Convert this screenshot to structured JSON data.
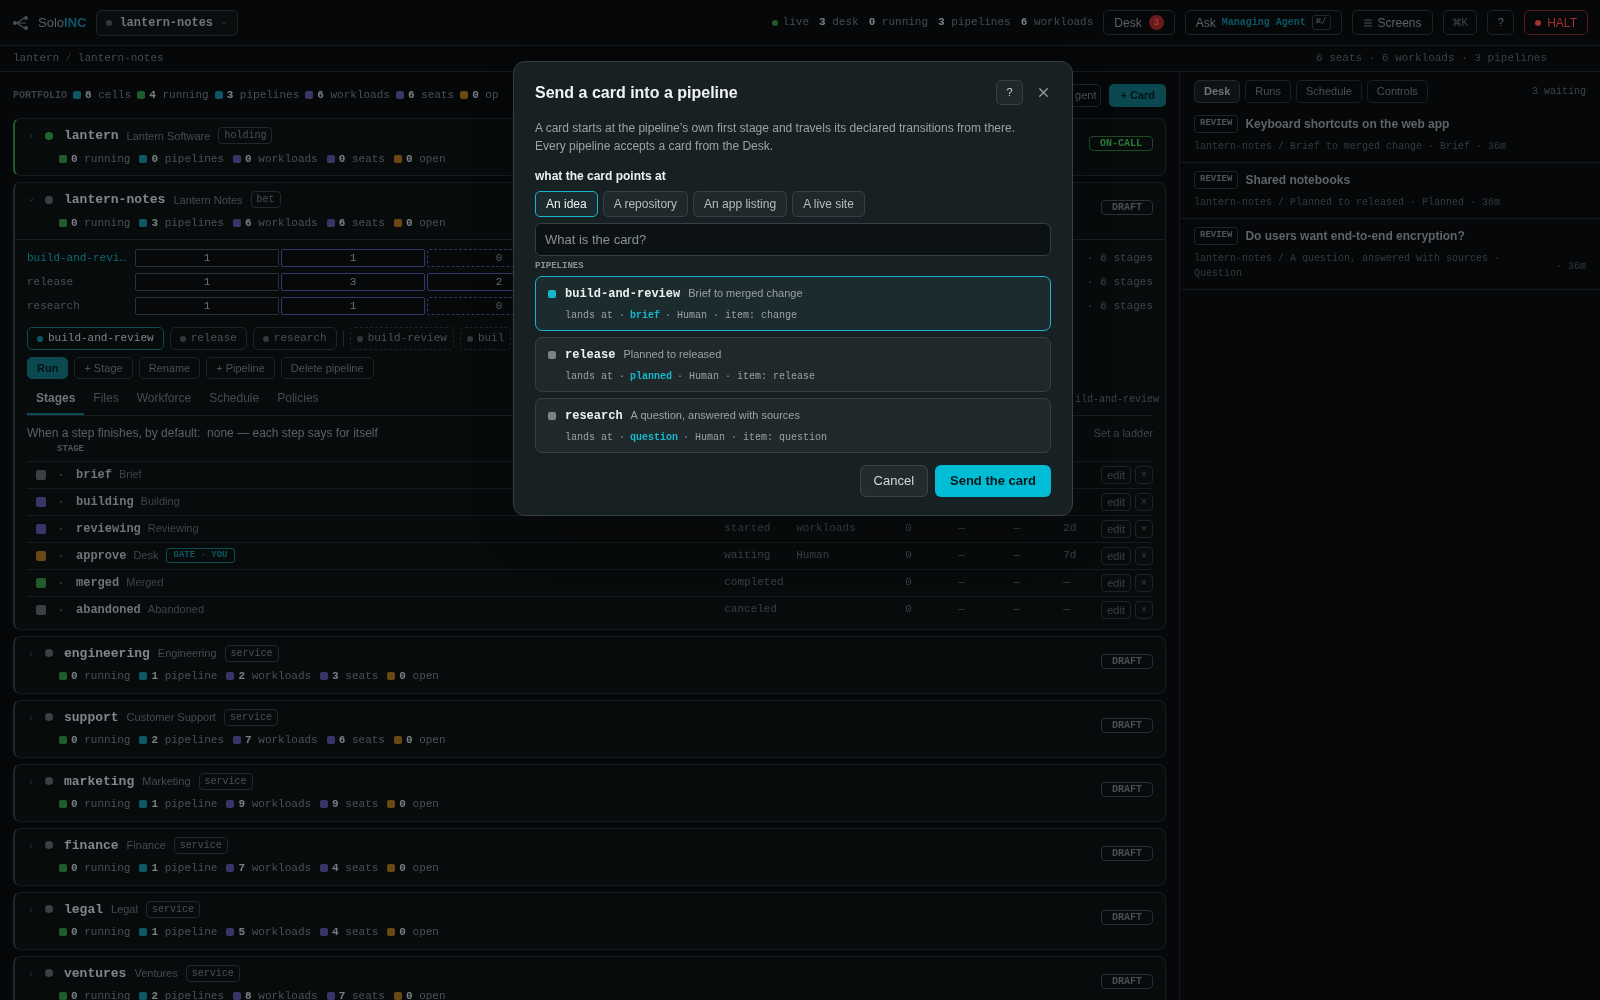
{
  "topbar": {
    "brand_prefix": "Solo",
    "brand_suffix": "INC",
    "project": "lantern-notes",
    "live": "live",
    "stats": [
      {
        "text": "**3** desk"
      },
      {
        "text": "**0** running"
      },
      {
        "text": "**3** pipelines"
      },
      {
        "text": "**6** workloads"
      }
    ],
    "desk": {
      "label": "Desk",
      "badge": "3"
    },
    "ask": {
      "label": "Ask",
      "agent": "Managing Agent",
      "shortcut": "⌘/"
    },
    "screens": "Screens",
    "palette": "⌘K",
    "help": "?",
    "halt": "HALT"
  },
  "breadcrumb": {
    "items": [
      "lantern",
      "lantern-notes"
    ],
    "separator": "/"
  },
  "summary": "6 seats · 6 workloads · 3 pipelines",
  "portfolio": {
    "label": "PORTFOLIO",
    "stats": [
      {
        "text": "**8** cells",
        "color": "#0d5864"
      },
      {
        "text": "**4** running",
        "color": "#1e5c2c"
      },
      {
        "text": "**3** pipelines",
        "color": "#0d5864"
      },
      {
        "text": "**6** workloads",
        "color": "#3b3468"
      },
      {
        "text": "**6** seats",
        "color": "#3b3468"
      },
      {
        "text": "**0** op",
        "color": "#6a4813"
      }
    ],
    "agent_button": "gent",
    "card_button": "+ Card"
  },
  "cells": [
    {
      "name": "lantern",
      "title": "Lantern Software",
      "tag": "holding",
      "badge": {
        "label": "ON-CALL",
        "kind": "oncall"
      },
      "color": "#1e6a2e",
      "expanded": false,
      "stats": [
        {
          "value": "0",
          "label": "running",
          "color": "#1e5c2c"
        },
        {
          "value": "0",
          "label": "pipelines",
          "color": "#0d5864"
        },
        {
          "value": "0",
          "label": "workloads",
          "color": "#3b3468"
        },
        {
          "value": "0",
          "label": "seats",
          "color": "#3b3468"
        },
        {
          "value": "0",
          "label": "open",
          "color": "#6a4813"
        }
      ]
    },
    {
      "name": "lantern-notes",
      "title": "Lantern Notes",
      "tag": "bet",
      "badge": {
        "label": "DRAFT",
        "kind": "draft"
      },
      "color": "#3a3f41",
      "expanded": true,
      "stats": [
        {
          "value": "0",
          "label": "running",
          "color": "#1e5c2c"
        },
        {
          "value": "3",
          "label": "pipelines",
          "color": "#0d5864"
        },
        {
          "value": "6",
          "label": "workloads",
          "color": "#3b3468"
        },
        {
          "value": "6",
          "label": "seats",
          "color": "#3b3468"
        },
        {
          "value": "0",
          "label": "open",
          "color": "#6a4813"
        }
      ],
      "detail": {
        "grid": [
          {
            "name": "build-and-revi…",
            "selected": true,
            "cells": [
              {
                "value": "1",
                "kind": "plain"
              },
              {
                "value": "1",
                "kind": "active"
              },
              {
                "value": "0",
                "kind": "empty"
              }
            ],
            "stages": "· 6 stages"
          },
          {
            "name": "release",
            "selected": false,
            "cells": [
              {
                "value": "1",
                "kind": "plain"
              },
              {
                "value": "3",
                "kind": "active"
              },
              {
                "value": "2",
                "kind": "active"
              }
            ],
            "stages": "· 6 stages"
          },
          {
            "name": "research",
            "selected": false,
            "cells": [
              {
                "value": "1",
                "kind": "plain"
              },
              {
                "value": "1",
                "kind": "active"
              },
              {
                "value": "0",
                "kind": "empty"
              }
            ],
            "stages": "· 6 stages"
          }
        ],
        "chips": [
          {
            "label": "build-and-review",
            "selected": true,
            "kind": "pipeline"
          },
          {
            "label": "release",
            "selected": false,
            "kind": "pipeline"
          },
          {
            "label": "research",
            "selected": false,
            "kind": "pipeline"
          },
          {
            "label": "build-review",
            "selected": false,
            "kind": "draft"
          },
          {
            "label": "buil",
            "selected": false,
            "kind": "draft"
          }
        ],
        "actions": [
          {
            "label": "Run",
            "kind": "primary"
          },
          {
            "label": "+ Stage",
            "kind": "plain"
          },
          {
            "label": "Rename",
            "kind": "plain"
          },
          {
            "label": "+ Pipeline",
            "kind": "plain"
          },
          {
            "label": "Delete pipeline",
            "kind": "plain"
          }
        ],
        "tabs": [
          {
            "label": "Stages",
            "selected": true
          },
          {
            "label": "Files",
            "selected": false
          },
          {
            "label": "Workforce",
            "selected": false
          },
          {
            "label": "Schedule",
            "selected": false
          },
          {
            "label": "Policies",
            "selected": false
          }
        ],
        "tabs_note": "ild-and-review",
        "default_line": "When a step finishes, by default:  none — each step says for itself",
        "ladder_link": "Set a ladder",
        "stage_header": "STAGE",
        "stages": [
          {
            "name": "brief",
            "title": "Brief",
            "color": "#3a3f41",
            "actions": [
              "edit",
              "×"
            ]
          },
          {
            "name": "building",
            "title": "Building",
            "color": "#3b3468",
            "actions": [
              "edit",
              "×"
            ]
          },
          {
            "name": "reviewing",
            "title": "Reviewing",
            "color": "#3b3468",
            "cols": {
              "status": "started",
              "role": "workloads",
              "count": "0",
              "column_5": "—",
              "column_6": "—",
              "time": "2d"
            },
            "actions": [
              "edit",
              "×"
            ]
          },
          {
            "name": "approve",
            "title": "Desk",
            "gate": "GATE · YOU",
            "color": "#6a4813",
            "cols": {
              "status": "waiting",
              "role": "Human",
              "count": "0",
              "column_5": "—",
              "column_6": "—",
              "time": "7d"
            },
            "actions": [
              "edit",
              "×"
            ]
          },
          {
            "name": "merged",
            "title": "Merged",
            "color": "#1e5c2c",
            "cols": {
              "status": "completed",
              "count": "0",
              "column_5": "—",
              "column_6": "—",
              "time": "—"
            },
            "actions": [
              "edit",
              "×"
            ]
          },
          {
            "name": "abandoned",
            "title": "Abandoned",
            "color": "#3a3f41",
            "cols": {
              "status": "canceled",
              "count": "0",
              "column_5": "—",
              "column_6": "—",
              "time": "—"
            },
            "actions": [
              "edit",
              "×"
            ]
          }
        ]
      }
    },
    {
      "name": "engineering",
      "title": "Engineering",
      "tag": "service",
      "badge": {
        "label": "DRAFT",
        "kind": "draft"
      },
      "color": "#3a3f41",
      "expanded": false,
      "stats": [
        {
          "value": "0",
          "label": "running",
          "color": "#1e5c2c"
        },
        {
          "value": "1",
          "label": "pipeline",
          "color": "#0d5864"
        },
        {
          "value": "2",
          "label": "workloads",
          "color": "#3b3468"
        },
        {
          "value": "3",
          "label": "seats",
          "color": "#3b3468"
        },
        {
          "value": "0",
          "label": "open",
          "color": "#6a4813"
        }
      ]
    },
    {
      "name": "support",
      "title": "Customer Support",
      "tag": "service",
      "badge": {
        "label": "DRAFT",
        "kind": "draft"
      },
      "color": "#3a3f41",
      "expanded": false,
      "stats": [
        {
          "value": "0",
          "label": "running",
          "color": "#1e5c2c"
        },
        {
          "value": "2",
          "label": "pipelines",
          "color": "#0d5864"
        },
        {
          "value": "7",
          "label": "workloads",
          "color": "#3b3468"
        },
        {
          "value": "6",
          "label": "seats",
          "color": "#3b3468"
        },
        {
          "value": "0",
          "label": "open",
          "color": "#6a4813"
        }
      ]
    },
    {
      "name": "marketing",
      "title": "Marketing",
      "tag": "service",
      "badge": {
        "label": "DRAFT",
        "kind": "draft"
      },
      "color": "#3a3f41",
      "expanded": false,
      "stats": [
        {
          "value": "0",
          "label": "running",
          "color": "#1e5c2c"
        },
        {
          "value": "1",
          "label": "pipeline",
          "color": "#0d5864"
        },
        {
          "value": "9",
          "label": "workloads",
          "color": "#3b3468"
        },
        {
          "value": "9",
          "label": "seats",
          "color": "#3b3468"
        },
        {
          "value": "0",
          "label": "open",
          "color": "#6a4813"
        }
      ]
    },
    {
      "name": "finance",
      "title": "Finance",
      "tag": "service",
      "badge": {
        "label": "DRAFT",
        "kind": "draft"
      },
      "color": "#3a3f41",
      "expanded": false,
      "stats": [
        {
          "value": "0",
          "label": "running",
          "color": "#1e5c2c"
        },
        {
          "value": "1",
          "label": "pipeline",
          "color": "#0d5864"
        },
        {
          "value": "7",
          "label": "workloads",
          "color": "#3b3468"
        },
        {
          "value": "4",
          "label": "seats",
          "color": "#3b3468"
        },
        {
          "value": "0",
          "label": "open",
          "color": "#6a4813"
        }
      ]
    },
    {
      "name": "legal",
      "title": "Legal",
      "tag": "service",
      "badge": {
        "label": "DRAFT",
        "kind": "draft"
      },
      "color": "#3a3f41",
      "expanded": false,
      "stats": [
        {
          "value": "0",
          "label": "running",
          "color": "#1e5c2c"
        },
        {
          "value": "1",
          "label": "pipeline",
          "color": "#0d5864"
        },
        {
          "value": "5",
          "label": "workloads",
          "color": "#3b3468"
        },
        {
          "value": "4",
          "label": "seats",
          "color": "#3b3468"
        },
        {
          "value": "0",
          "label": "open",
          "color": "#6a4813"
        }
      ]
    },
    {
      "name": "ventures",
      "title": "Ventures",
      "tag": "service",
      "badge": {
        "label": "DRAFT",
        "kind": "draft"
      },
      "color": "#3a3f41",
      "expanded": false,
      "stats": [
        {
          "value": "0",
          "label": "running",
          "color": "#1e5c2c"
        },
        {
          "value": "2",
          "label": "pipelines",
          "color": "#0d5864"
        },
        {
          "value": "8",
          "label": "workloads",
          "color": "#3b3468"
        },
        {
          "value": "7",
          "label": "seats",
          "color": "#3b3468"
        },
        {
          "value": "0",
          "label": "open",
          "color": "#6a4813"
        }
      ]
    }
  ],
  "desk_panel": {
    "tabs": [
      {
        "label": "Desk",
        "selected": true
      },
      {
        "label": "Runs",
        "selected": false
      },
      {
        "label": "Schedule",
        "selected": false
      },
      {
        "label": "Controls",
        "selected": false
      }
    ],
    "count": "3 waiting",
    "items": [
      {
        "tag": "REVIEW",
        "title": "Keyboard shortcuts on the web app",
        "meta": "lantern-notes / Brief to merged change · Brief",
        "time": "· 36m"
      },
      {
        "tag": "REVIEW",
        "title": "Shared notebooks",
        "meta": "lantern-notes / Planned to released · Planned",
        "time": "· 36m"
      },
      {
        "tag": "REVIEW",
        "title": "Do users want end-to-end encryption?",
        "meta": "lantern-notes / A question, answered with sources · Question",
        "time": "· 36m"
      }
    ]
  },
  "modal": {
    "title": "Send a card into a pipeline",
    "help": "?",
    "description": "A card starts at the pipeline’s own first stage and travels its declared transitions from there. Every pipeline accepts a card from the Desk.",
    "target_label": "what the card points at",
    "targets": [
      {
        "label": "An idea",
        "selected": true
      },
      {
        "label": "A repository",
        "selected": false
      },
      {
        "label": "An app listing",
        "selected": false
      },
      {
        "label": "A live site",
        "selected": false
      }
    ],
    "placeholder": "What is the card?",
    "section": "PIPELINES",
    "pipelines": [
      {
        "name": "build-and-review",
        "desc": "Brief to merged change",
        "selected": true,
        "line": [
          {
            "text": "lands at ·",
            "kind": "plain"
          },
          {
            "text": "brief",
            "kind": "stage"
          },
          {
            "text": "· Human · item: change",
            "kind": "plain"
          }
        ]
      },
      {
        "name": "release",
        "desc": "Planned to released",
        "selected": false,
        "line": [
          {
            "text": "lands at ·",
            "kind": "plain"
          },
          {
            "text": "planned",
            "kind": "stage"
          },
          {
            "text": "· Human · item: release",
            "kind": "plain"
          }
        ]
      },
      {
        "name": "research",
        "desc": "A question, answered with sources",
        "selected": false,
        "line": [
          {
            "text": "lands at ·",
            "kind": "plain"
          },
          {
            "text": "question",
            "kind": "stage"
          },
          {
            "text": "· Human · item: question",
            "kind": "plain"
          }
        ]
      }
    ],
    "cancel": "Cancel",
    "submit": "Send the card"
  }
}
